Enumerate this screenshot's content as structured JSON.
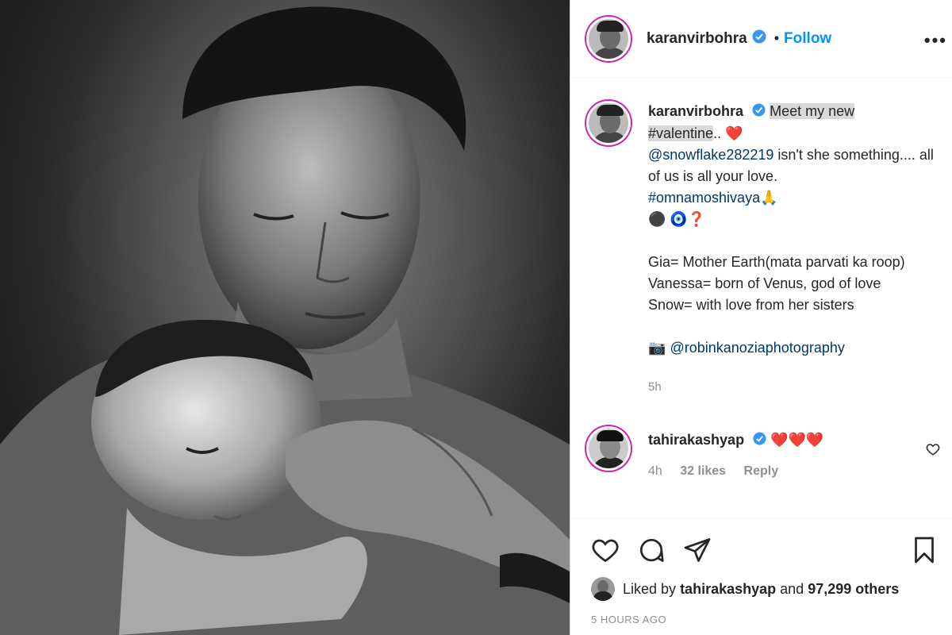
{
  "post": {
    "username": "karanvirbohra",
    "follow_label": "Follow",
    "dot": "•",
    "more_label": "•••",
    "caption": {
      "username": "karanvirbohra",
      "text_hl_1": "Meet my new",
      "text_hl_2": "#valentine",
      "text_after": "..",
      "emoji_heart": "❤️",
      "mention": "@snowflake282219",
      "line2": " isn't she something.... all of us is all your love.",
      "hashtag": "#omnamoshivaya",
      "emoji_pray": "🙏",
      "emoji_row": "⚫ 🧿❓",
      "gia": "Gia= Mother Earth(mata parvati ka roop)",
      "vanessa": "Vanessa= born of Venus, god of love",
      "snow": "Snow= with love from her sisters",
      "camera": "📷",
      "photo_credit": "@robinkanoziaphotography",
      "time": "5h"
    },
    "comment": {
      "username": "tahirakashyap",
      "text": "❤️❤️❤️",
      "time": "4h",
      "likes": "32 likes",
      "reply": "Reply"
    },
    "liked_by_prefix": "Liked by",
    "liked_by_user": "tahirakashyap",
    "liked_by_and": "and",
    "liked_by_count": "97,299 others",
    "posted_ago": "5 HOURS AGO"
  },
  "colors": {
    "accent": "#0095f6",
    "link": "#00376b",
    "muted": "#8e8e8e",
    "highlight": "#d9d9d9"
  },
  "icons": [
    "heart-icon",
    "comment-icon",
    "share-icon",
    "bookmark-icon",
    "verified-icon",
    "more-icon"
  ]
}
